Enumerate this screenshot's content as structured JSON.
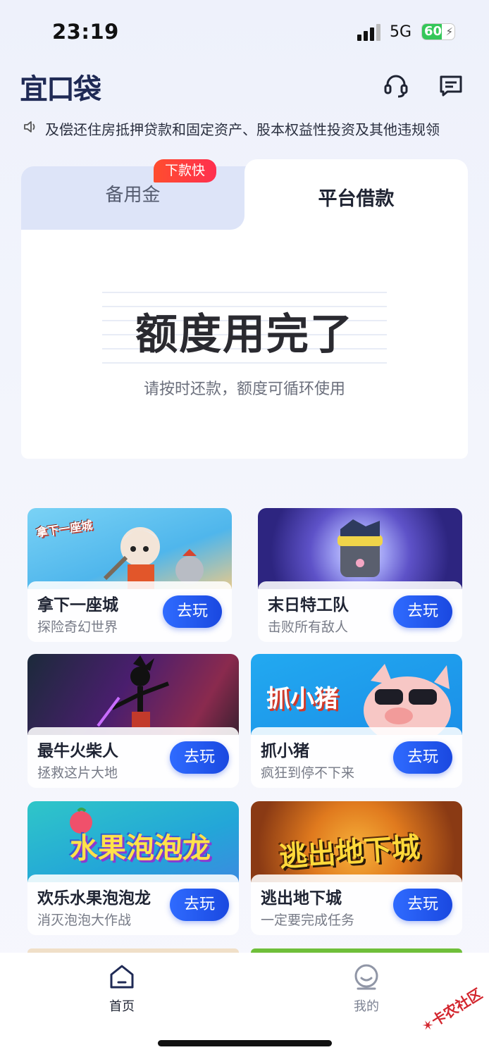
{
  "status_bar": {
    "time": "23:19",
    "network": "5G",
    "battery": "60",
    "battery_level_percent": 60
  },
  "header": {
    "logo": "宜口袋",
    "icons": [
      "headset-icon",
      "message-icon"
    ]
  },
  "notice": {
    "icon": "speaker-icon",
    "text": "及偿还住房抵押贷款和固定资产、股本权益性投资及其他违规领"
  },
  "loan_card": {
    "tab_left": "备用金",
    "tab_left_badge": "下款快",
    "tab_right": "平台借款",
    "quota_title": "额度用完了",
    "quota_subtitle": "请按时还款，额度可循环使用"
  },
  "games": [
    {
      "name": "拿下一座城",
      "desc": "探险奇幻世界",
      "button": "去玩",
      "art_title": "拿下一座城"
    },
    {
      "name": "末日特工队",
      "desc": "击败所有敌人",
      "button": "去玩",
      "art_title": ""
    },
    {
      "name": "最牛火柴人",
      "desc": "拯救这片大地",
      "button": "去玩",
      "art_title": ""
    },
    {
      "name": "抓小猪",
      "desc": "疯狂到停不下来",
      "button": "去玩",
      "art_title": "抓小猪"
    },
    {
      "name": "欢乐水果泡泡龙",
      "desc": "消灭泡泡大作战",
      "button": "去玩",
      "art_title": "水果泡泡龙"
    },
    {
      "name": "逃出地下城",
      "desc": "一定要完成任务",
      "button": "去玩",
      "art_title": "逃出地下城"
    }
  ],
  "bottom_nav": {
    "home": "首页",
    "mine": "我的"
  },
  "watermark": "卡农社区",
  "colors": {
    "accent_blue": "#2f6bff",
    "logo_navy": "#1f2a55",
    "badge_red": "#ff3b3b"
  }
}
